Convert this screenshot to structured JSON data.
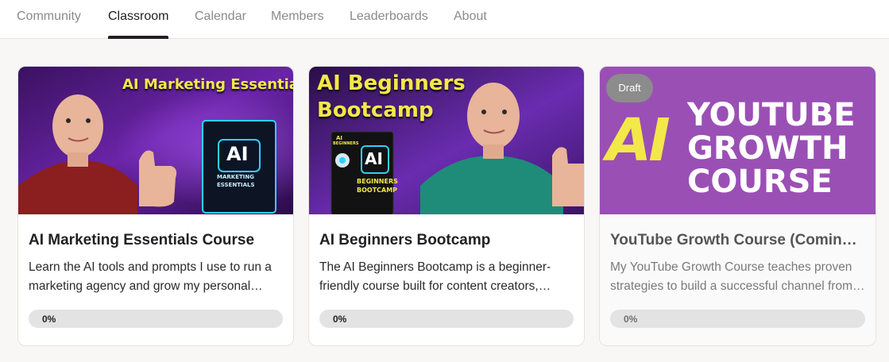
{
  "nav": {
    "tabs": [
      {
        "label": "Community"
      },
      {
        "label": "Classroom"
      },
      {
        "label": "Calendar"
      },
      {
        "label": "Members"
      },
      {
        "label": "Leaderboards"
      },
      {
        "label": "About"
      }
    ],
    "active_tab": "Classroom"
  },
  "courses": [
    {
      "title": "AI Marketing Essentials Course",
      "description": "Learn the AI tools and prompts I use to run a marketing agency and grow my personal brand.",
      "progress_label": "0%",
      "progress": 0,
      "thumbnail": {
        "headline": "AI Marketing Essentials",
        "box_big": "AI",
        "box_line1": "MARKETING",
        "box_line2": "ESSENTIALS",
        "colors": {
          "bg": "#5a1c8a",
          "headline": "#f3e84a",
          "shirt": "#8b1f1f"
        }
      }
    },
    {
      "title": "AI Beginners Bootcamp",
      "description": "The AI Beginners Bootcamp is a beginner-friendly course built for content creators, marketers and business owners.",
      "progress_label": "0%",
      "progress": 0,
      "thumbnail": {
        "headline_line1": "AI Beginners",
        "headline_line2": "Bootcamp",
        "box_small": "AI",
        "box_small2": "BEGINNERS",
        "box_big": "AI",
        "box_line1": "BEGINNERS",
        "box_line2": "BOOTCAMP",
        "colors": {
          "bg": "#5a2a8c",
          "headline": "#f3e84a",
          "shirt": "#1f8c7a"
        }
      }
    },
    {
      "title": "YouTube Growth Course (Coming Soon)",
      "description": "My YouTube Growth Course teaches proven strategies to build a successful channel from scratch.",
      "progress_label": "0%",
      "progress": 0,
      "badge": "Draft",
      "thumbnail": {
        "big": "AI",
        "line1": "YOUTUBE",
        "line2": "GROWTH",
        "line3": "COURSE",
        "colors": {
          "bg": "#9a4fb5",
          "ai": "#f3e84a",
          "text": "#ffffff"
        }
      }
    }
  ]
}
